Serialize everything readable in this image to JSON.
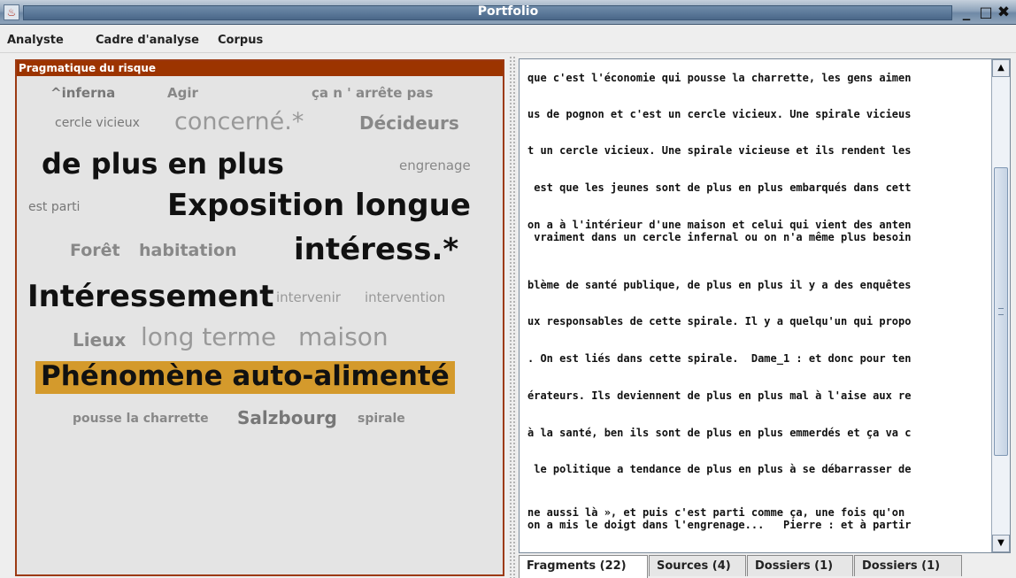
{
  "window": {
    "title": "Portfolio",
    "minimize": "_",
    "maximize": "□",
    "close": "✖",
    "app_icon": "♨"
  },
  "menu": [
    "Analyste",
    "Cadre d'analyse",
    "Corpus"
  ],
  "panel": {
    "title": "Pragmatique du risque",
    "highlight_color": "#d49a2c",
    "words": [
      {
        "text": "^inferna",
        "color": "#777"
      },
      {
        "text": "Agir",
        "color": "#888"
      },
      {
        "text": "ça n ' arrête pas",
        "color": "#888"
      },
      {
        "text": "cercle vicieux",
        "color": "#777"
      },
      {
        "text": "concerné.*",
        "color": "#999"
      },
      {
        "text": "Décideurs",
        "color": "#888"
      },
      {
        "text": "de plus en plus",
        "color": "#111"
      },
      {
        "text": "engrenage",
        "color": "#888"
      },
      {
        "text": "est parti",
        "color": "#777"
      },
      {
        "text": "Exposition longue",
        "color": "#111"
      },
      {
        "text": "Forêt",
        "color": "#888"
      },
      {
        "text": "habitation",
        "color": "#888"
      },
      {
        "text": "intéress.*",
        "color": "#111"
      },
      {
        "text": "Intéressement",
        "color": "#111"
      },
      {
        "text": "intervenir",
        "color": "#999"
      },
      {
        "text": "intervention",
        "color": "#999"
      },
      {
        "text": "Lieux",
        "color": "#888"
      },
      {
        "text": "long terme",
        "color": "#999"
      },
      {
        "text": "maison",
        "color": "#999"
      },
      {
        "text": "Phénomène auto-alimenté",
        "color": "#111"
      },
      {
        "text": "pousse la charrette",
        "color": "#888"
      },
      {
        "text": "Salzbourg",
        "color": "#777"
      },
      {
        "text": "spirale",
        "color": "#888"
      }
    ]
  },
  "fragments": [
    "que c'est l'économie qui pousse la charrette, les gens aimen",
    "us de pognon et c'est un cercle vicieux. Une spirale vicieus",
    "t un cercle vicieux. Une spirale vicieuse et ils rendent les",
    " est que les jeunes sont de plus en plus embarqués dans cett",
    "on a à l'intérieur d'une maison et celui qui vient des anten",
    " vraiment dans un cercle infernal ou on n'a même plus besoin",
    "blème de santé publique, de plus en plus il y a des enquêtes",
    "ux responsables de cette spirale. Il y a quelqu'un qui propo",
    ". On est liés dans cette spirale.  Dame_1 : et donc pour ten",
    "érateurs. Ils deviennent de plus en plus mal à l'aise aux re",
    "à la santé, ben ils sont de plus en plus emmerdés et ça va c",
    " le politique a tendance de plus en plus à se débarrasser de",
    "ne aussi là », et puis c'est parti comme ça, une fois qu'on",
    "on a mis le doigt dans l'engrenage...   Pierre : et à partir"
  ],
  "scrollbar": {
    "up": "▲",
    "down": "▼"
  },
  "tabs": [
    "Fragments (22)",
    "Sources (4)",
    "Dossiers (1)",
    "Dossiers (1)"
  ]
}
